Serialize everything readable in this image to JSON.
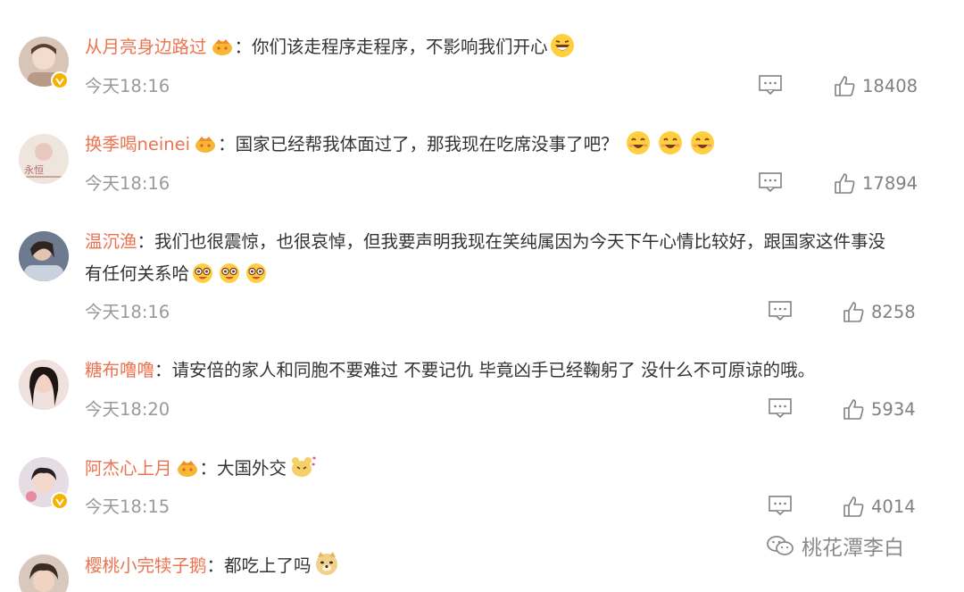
{
  "comments": [
    {
      "user": "从月亮身边路过",
      "text": "你们该走程序走程序，不影响我们开心",
      "time": "今天18:16",
      "likes": "18408",
      "emoji_names": [
        "laugh-emoji"
      ]
    },
    {
      "user": "换季喝neinei",
      "text": "国家已经帮我体面过了，那我现在吃席没事了吧？",
      "time": "今天18:16",
      "likes": "17894",
      "emoji_names": [
        "smile-emoji",
        "smile-emoji",
        "smile-emoji"
      ]
    },
    {
      "user": "温沉渔",
      "text": "我们也很震惊，也很哀悼，但我要声明我现在笑纯属因为今天下午心情比较好，跟国家这件事没",
      "text2": "有任何关系哈",
      "time": "今天18:16",
      "likes": "8258",
      "emoji_names": [
        "laugh-cry-emoji",
        "laugh-cry-emoji",
        "laugh-cry-emoji"
      ]
    },
    {
      "user": "糖布噜噜",
      "text": "请安倍的家人和同胞不要难过 不要记仇 毕竟凶手已经鞠躬了 没什么不可原谅的哦。",
      "time": "今天18:20",
      "likes": "5934"
    },
    {
      "user": "阿杰心上月",
      "text": "大国外交",
      "time": "今天18:15",
      "likes": "4014",
      "emoji_names": [
        "hamster-emoji"
      ]
    },
    {
      "user": "樱桃小完犊子鹅",
      "text": "都吃上了吗",
      "emoji_names": [
        "doge-emoji"
      ]
    }
  ],
  "watermark": {
    "text": "桃花潭李白"
  },
  "colors": {
    "username": "#eb7350",
    "text": "#333333",
    "meta": "#999999",
    "badge": "#f5b300"
  }
}
